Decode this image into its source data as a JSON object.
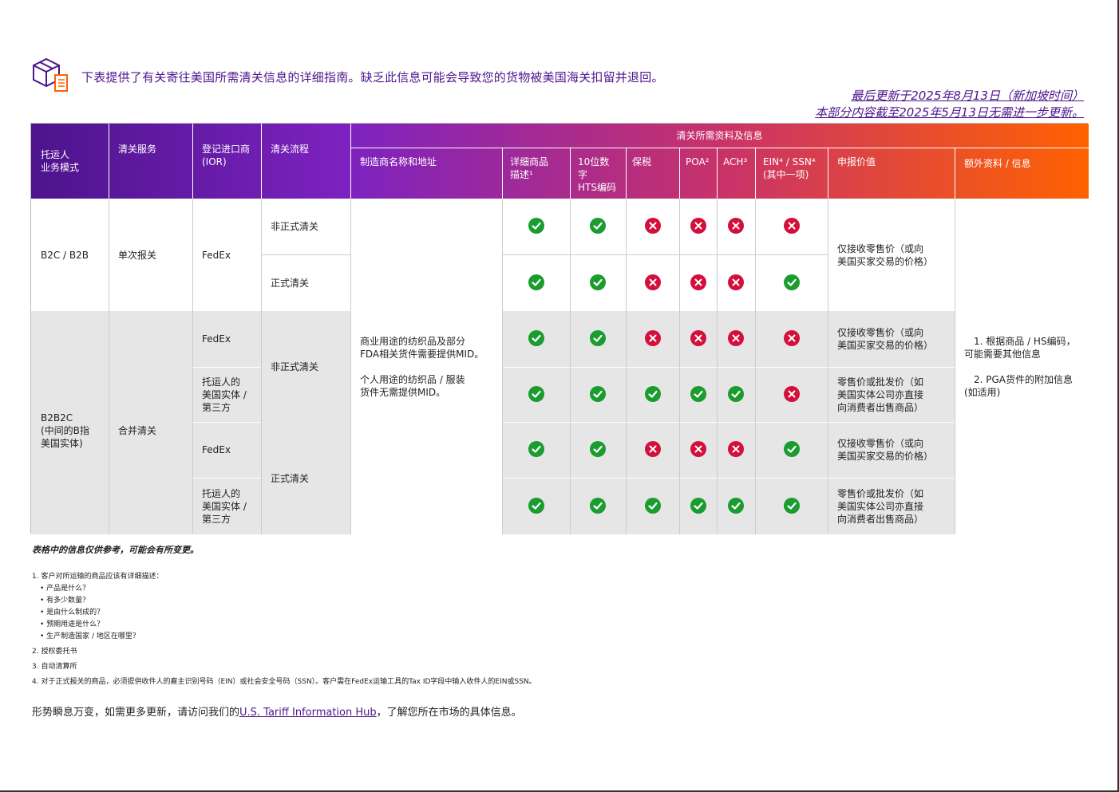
{
  "intro": {
    "icon": "package-document-icon",
    "text": "下表提供了有关寄往美国所需清关信息的详细指南。缺乏此信息可能会导致您的货物被美国海关扣留并退回。"
  },
  "updated": {
    "line1": "最后更新于2025年8月13日（新加坡时间）",
    "line2": "本部分内容截至2025年5月13日无需进一步更新。"
  },
  "table": {
    "headers": {
      "shipper_model": [
        "托运人",
        "业务模式"
      ],
      "clearance_service": "清关服务",
      "ior": [
        "登记进口商",
        "(IOR)"
      ],
      "process": "清关流程",
      "required_group": "清关所需资料及信息",
      "manufacturer": "制造商名称和地址",
      "description": [
        "详细商品",
        "描述¹"
      ],
      "hts": [
        "10位数字",
        "HTS编码"
      ],
      "bond": "保税",
      "poa": "POA²",
      "ach": "ACH³",
      "ein": [
        "EIN⁴ / SSN⁴",
        "(其中一项)"
      ],
      "declared_value": "申报价值",
      "additional": "额外资料 / 信息"
    },
    "groups": {
      "b2c": {
        "model": "B2C / B2B",
        "service": "单次报关",
        "ior": "FedEx"
      },
      "b2b2c": {
        "model": [
          "B2B2C",
          "(中间的B指",
          "美国实体)"
        ],
        "service": "合并清关"
      }
    },
    "rows": [
      {
        "ior": "",
        "process": "非正式清关",
        "marks": [
          true,
          true,
          false,
          false,
          false,
          false
        ]
      },
      {
        "ior": "",
        "process": "正式清关",
        "marks": [
          true,
          true,
          false,
          false,
          false,
          true
        ]
      },
      {
        "ior": [
          "FedEx"
        ],
        "process": "",
        "marks": [
          true,
          true,
          false,
          false,
          false,
          false
        ],
        "value": [
          "仅接收零售价（或向",
          "美国买家交易的价格）"
        ]
      },
      {
        "ior": [
          "托运人的",
          "美国实体 /",
          "第三方"
        ],
        "process": "",
        "marks": [
          true,
          true,
          true,
          true,
          true,
          false
        ],
        "value": [
          "零售价或批发价（如",
          "美国实体公司亦直接",
          "向消费者出售商品）"
        ]
      },
      {
        "ior": [
          "FedEx"
        ],
        "process": "",
        "marks": [
          true,
          true,
          false,
          false,
          false,
          true
        ],
        "value": [
          "仅接收零售价（或向",
          "美国买家交易的价格）"
        ]
      },
      {
        "ior": [
          "托运人的",
          "美国实体 /",
          "第三方"
        ],
        "process": "",
        "marks": [
          true,
          true,
          true,
          true,
          true,
          true
        ],
        "value": [
          "零售价或批发价（如",
          "美国实体公司亦直接",
          "向消费者出售商品）"
        ]
      }
    ],
    "b2b2c_process": {
      "informal": "非正式清关",
      "formal": "正式清关"
    },
    "b2c_value": [
      "仅接收零售价（或向",
      "美国买家交易的价格）"
    ],
    "manufacturer_text": [
      "商业用途的纺织品及部分",
      "FDA相关货件需要提供MID。",
      "",
      "个人用途的纺织品 / 服装",
      "货件无需提供MID。"
    ],
    "additional_text": [
      "1. 根据商品 / HS编码，",
      "可能需要其他信息",
      "",
      "2. PGA货件的附加信息",
      "(如适用)"
    ]
  },
  "note_italic": "表格中的信息仅供参考，可能会有所变更。",
  "notes": {
    "n1": "1. 客户对所运输的商品应该有详细描述：",
    "n1_items": [
      "•  产品是什么？",
      "•  有多少数量？",
      "•  是由什么制成的？",
      "•  预期用途是什么？",
      "•  生产制造国家 / 地区在哪里？"
    ],
    "n2": "2. 授权委托书",
    "n3": "3. 自动清算所",
    "n4": "4. 对于正式报关的商品，必须提供收件人的雇主识别号码（EIN）或社会安全号码（SSN）。客户需在FedEx运输工具的Tax ID字段中输入收件人的EIN或SSN。"
  },
  "footer": {
    "before": "形势瞬息万变，如需更多更新，请访问我们的",
    "link": "U.S. Tariff Information Hub",
    "after": "，了解您所在市场的具体信息。"
  },
  "colors": {
    "purple": "#4d148c",
    "orange": "#ff6200",
    "check": "#1a9c2e",
    "cross": "#d3103b",
    "grey": "#e6e6e6"
  }
}
